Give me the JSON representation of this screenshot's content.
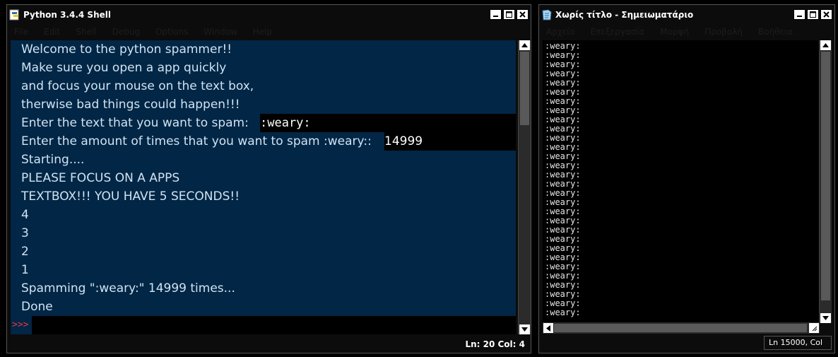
{
  "shell": {
    "title": "Python 3.4.4 Shell",
    "menu": [
      "File",
      "Edit",
      "Shell",
      "Debug",
      "Options",
      "Window",
      "Help"
    ],
    "lines": [
      {
        "text": "Welcome to the python spammer!!"
      },
      {
        "text": "Make sure you open a app quickly"
      },
      {
        "text": "and focus your mouse on the text box,"
      },
      {
        "text": "therwise bad things could happen!!!"
      },
      {
        "text": "Enter the text that you want to spam: ",
        "input": ":weary:"
      },
      {
        "text": "Enter the amount of times that you want to spam :weary:: ",
        "input": "14999"
      },
      {
        "text": "Starting...."
      },
      {
        "text": "PLEASE FOCUS ON A APPS"
      },
      {
        "text": "TEXTBOX!!! YOU HAVE 5 SECONDS!!"
      },
      {
        "text": "4"
      },
      {
        "text": "3"
      },
      {
        "text": "2"
      },
      {
        "text": "1"
      },
      {
        "text": "Spamming \":weary:\" 14999 times..."
      },
      {
        "text": "Done"
      }
    ],
    "prompt": ">>>",
    "status": "Ln: 20  Col: 4"
  },
  "notepad": {
    "title": "Χωρίς τίτλο - Σημειωματάριο",
    "menu": [
      "Αρχείο",
      "Επεξεργασία",
      "Μορφή",
      "Προβολή",
      "Βοήθεια"
    ],
    "line_text": ":weary:",
    "line_count": 30,
    "status": "Ln 15000, Col"
  },
  "icons": {
    "shell_app": "python-idle-icon",
    "notepad_app": "notepad-icon",
    "minimize": "minimize-icon",
    "maximize": "maximize-icon",
    "close": "close-icon"
  }
}
